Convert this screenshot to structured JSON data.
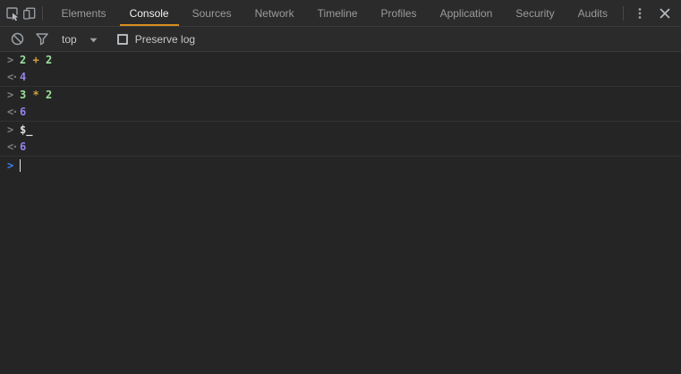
{
  "colors": {
    "accent": "#d98f1f",
    "num": "#9ce29c",
    "op": "#cfa13f",
    "ident": "#e0e0e0",
    "resultnum": "#9482ea",
    "prompt": "#3b82f6"
  },
  "tabbar": {
    "tabs": [
      {
        "label": "Elements",
        "active": false
      },
      {
        "label": "Console",
        "active": true
      },
      {
        "label": "Sources",
        "active": false
      },
      {
        "label": "Network",
        "active": false
      },
      {
        "label": "Timeline",
        "active": false
      },
      {
        "label": "Profiles",
        "active": false
      },
      {
        "label": "Application",
        "active": false
      },
      {
        "label": "Security",
        "active": false
      },
      {
        "label": "Audits",
        "active": false
      }
    ]
  },
  "toolbar": {
    "context_label": "top",
    "preserve_log_label": "Preserve log",
    "preserve_log_checked": false
  },
  "console": {
    "history_prompt_glyph": ">",
    "return_glyph": "<·",
    "prompt_glyph": ">",
    "entries": [
      {
        "input_text": "2 + 2",
        "input_tokens": [
          {
            "text": "2",
            "type": "number"
          },
          {
            "text": " ",
            "type": "plain"
          },
          {
            "text": "+",
            "type": "op"
          },
          {
            "text": " ",
            "type": "plain"
          },
          {
            "text": "2",
            "type": "number"
          }
        ],
        "result": "4"
      },
      {
        "input_text": "3 * 2",
        "input_tokens": [
          {
            "text": "3",
            "type": "number"
          },
          {
            "text": " ",
            "type": "plain"
          },
          {
            "text": "*",
            "type": "op"
          },
          {
            "text": " ",
            "type": "plain"
          },
          {
            "text": "2",
            "type": "number"
          }
        ],
        "result": "6"
      },
      {
        "input_text": "$_",
        "input_tokens": [
          {
            "text": "$_",
            "type": "ident"
          }
        ],
        "result": "6"
      }
    ]
  }
}
